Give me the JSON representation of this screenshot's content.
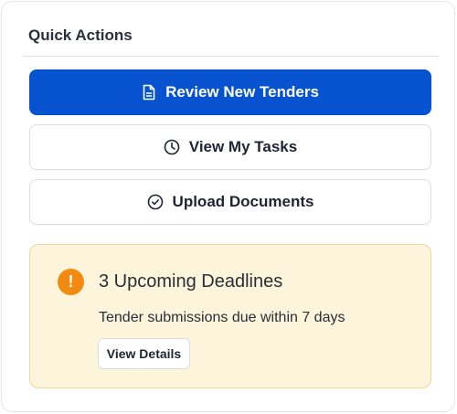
{
  "panel": {
    "title": "Quick Actions"
  },
  "actions": {
    "review": {
      "label": "Review New Tenders",
      "icon": "document-icon"
    },
    "tasks": {
      "label": "View My Tasks",
      "icon": "clock-icon"
    },
    "upload": {
      "label": "Upload Documents",
      "icon": "check-circle-icon"
    }
  },
  "alert": {
    "icon": "exclamation-icon",
    "icon_glyph": "!",
    "title": "3 Upcoming Deadlines",
    "text": "Tender submissions due within 7 days",
    "button_label": "View Details"
  },
  "colors": {
    "primary": "#0652cf",
    "warning_bg": "#fdf4dc",
    "warning_border": "#f2d79a",
    "warning_icon": "#f38a10"
  }
}
